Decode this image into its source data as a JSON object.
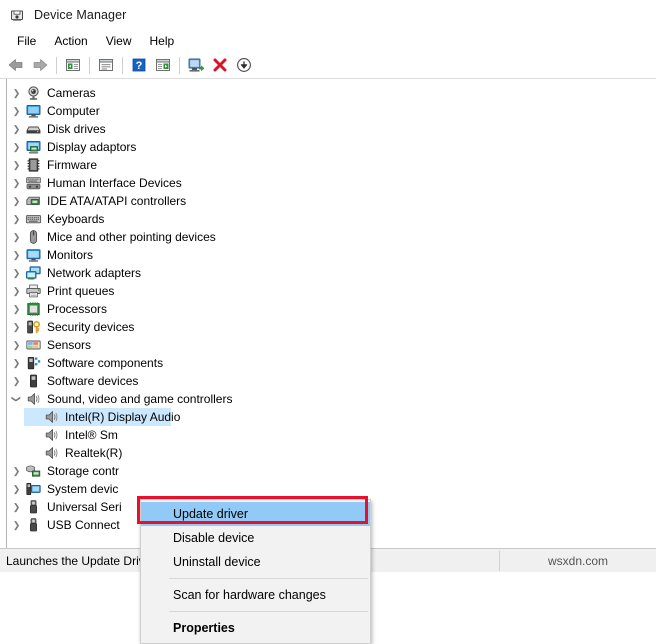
{
  "window": {
    "title": "Device Manager",
    "icon": "device-manager-icon"
  },
  "menubar": {
    "items": [
      {
        "label": "File",
        "name": "menu-file"
      },
      {
        "label": "Action",
        "name": "menu-action"
      },
      {
        "label": "View",
        "name": "menu-view"
      },
      {
        "label": "Help",
        "name": "menu-help"
      }
    ]
  },
  "toolbar": {
    "buttons": [
      {
        "icon": "back-arrow-icon",
        "name": "toolbar-back"
      },
      {
        "icon": "forward-arrow-icon",
        "name": "toolbar-forward"
      },
      {
        "icon": "show-hide-console-tree-icon",
        "name": "toolbar-console-tree"
      },
      {
        "icon": "properties-icon",
        "name": "toolbar-properties"
      },
      {
        "icon": "help-icon",
        "name": "toolbar-help"
      },
      {
        "icon": "view-devices-icon",
        "name": "toolbar-view-devices"
      },
      {
        "icon": "scan-hardware-changes-icon",
        "name": "toolbar-scan-hardware"
      },
      {
        "icon": "update-driver-icon",
        "name": "toolbar-update-driver"
      },
      {
        "icon": "uninstall-device-icon",
        "name": "toolbar-uninstall-device"
      },
      {
        "icon": "disable-device-icon",
        "name": "toolbar-disable-device"
      }
    ]
  },
  "tree": {
    "items": [
      {
        "label": "Cameras",
        "icon": "camera-icon",
        "state": "collapsed",
        "level": 0
      },
      {
        "label": "Computer",
        "icon": "computer-icon",
        "state": "collapsed",
        "level": 0
      },
      {
        "label": "Disk drives",
        "icon": "disk-drive-icon",
        "state": "collapsed",
        "level": 0
      },
      {
        "label": "Display adaptors",
        "icon": "display-adapter-icon",
        "state": "collapsed",
        "level": 0
      },
      {
        "label": "Firmware",
        "icon": "firmware-chip-icon",
        "state": "collapsed",
        "level": 0
      },
      {
        "label": "Human Interface Devices",
        "icon": "hid-icon",
        "state": "collapsed",
        "level": 0
      },
      {
        "label": "IDE ATA/ATAPI controllers",
        "icon": "ide-controller-icon",
        "state": "collapsed",
        "level": 0
      },
      {
        "label": "Keyboards",
        "icon": "keyboard-icon",
        "state": "collapsed",
        "level": 0
      },
      {
        "label": "Mice and other pointing devices",
        "icon": "mouse-icon",
        "state": "collapsed",
        "level": 0
      },
      {
        "label": "Monitors",
        "icon": "monitor-icon",
        "state": "collapsed",
        "level": 0
      },
      {
        "label": "Network adapters",
        "icon": "network-adapter-icon",
        "state": "collapsed",
        "level": 0
      },
      {
        "label": "Print queues",
        "icon": "printer-icon",
        "state": "collapsed",
        "level": 0
      },
      {
        "label": "Processors",
        "icon": "processor-icon",
        "state": "collapsed",
        "level": 0
      },
      {
        "label": "Security devices",
        "icon": "security-device-icon",
        "state": "collapsed",
        "level": 0
      },
      {
        "label": "Sensors",
        "icon": "sensor-icon",
        "state": "collapsed",
        "level": 0
      },
      {
        "label": "Software components",
        "icon": "software-component-icon",
        "state": "collapsed",
        "level": 0
      },
      {
        "label": "Software devices",
        "icon": "software-device-icon",
        "state": "collapsed",
        "level": 0
      },
      {
        "label": "Sound, video and game controllers",
        "icon": "speaker-icon",
        "state": "expanded",
        "level": 0
      },
      {
        "label": "Intel(R) Display Audio",
        "icon": "speaker-icon",
        "state": "leaf",
        "level": 1,
        "selected": true
      },
      {
        "label": "Intel® Sm",
        "icon": "speaker-icon",
        "state": "leaf",
        "level": 1
      },
      {
        "label": "Realtek(R)",
        "icon": "speaker-icon",
        "state": "leaf",
        "level": 1
      },
      {
        "label": "Storage contr",
        "icon": "storage-controller-icon",
        "state": "collapsed",
        "level": 0
      },
      {
        "label": "System devic",
        "icon": "system-device-icon",
        "state": "collapsed",
        "level": 0
      },
      {
        "label": "Universal Seri",
        "icon": "usb-icon",
        "state": "collapsed",
        "level": 0
      },
      {
        "label": "USB Connect",
        "icon": "usb-icon",
        "state": "collapsed",
        "level": 0
      }
    ]
  },
  "context_menu": {
    "items": [
      {
        "label": "Update driver",
        "highlighted": true,
        "bold": false
      },
      {
        "label": "Disable device",
        "highlighted": false,
        "bold": false
      },
      {
        "label": "Uninstall device",
        "highlighted": false,
        "bold": false
      },
      {
        "separator": true
      },
      {
        "label": "Scan for hardware changes",
        "highlighted": false,
        "bold": false
      },
      {
        "separator": true
      },
      {
        "label": "Properties",
        "highlighted": false,
        "bold": true
      }
    ],
    "annotation_color": "#e8112d"
  },
  "statusbar": {
    "text": "Launches the Update Driver Wizard for the selected device.",
    "watermark": "wsxdn.com"
  },
  "colors": {
    "selection_blue": "#cce8ff",
    "menu_highlight": "#91c9f7",
    "annotation_red": "#e8112d",
    "window_bg": "#ffffff",
    "statusbar_bg": "#f0f0f0"
  }
}
